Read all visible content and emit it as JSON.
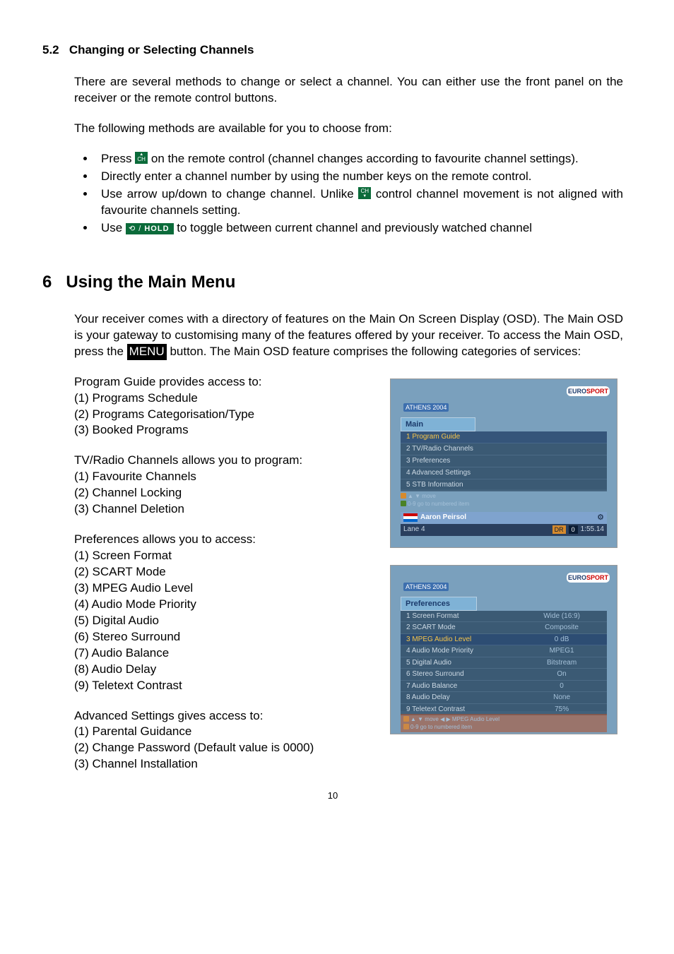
{
  "section52": {
    "number": "5.2",
    "title": "Changing or Selecting Channels",
    "intro": "There are several methods to change or select a channel. You can either use the front panel on the receiver or the remote control buttons.",
    "lead": "The following methods are available for you to choose from:",
    "b1a": "Press ",
    "b1b": " on the remote control (channel changes according to favourite channel settings).",
    "b2": "Directly enter a channel number by using the number keys on the remote control.",
    "b3a": "Use arrow up/down to change channel. Unlike ",
    "b3b": " control channel movement is not aligned with favourite channels setting.",
    "b4a": "Use ",
    "b4b": " to toggle between current channel and previously watched channel",
    "hold_label": "HOLD"
  },
  "section6": {
    "number": "6",
    "title": "Using the Main Menu",
    "intro_a": "Your receiver comes with a directory of features on the Main On Screen Display (OSD). The Main OSD is your gateway to customising many of the features offered by your receiver. To access the Main OSD, press the ",
    "menu_label": "MENU",
    "intro_b": " button. The Main OSD feature comprises the following categories of services:"
  },
  "blocks": {
    "pg_title": "Program Guide provides access to:",
    "pg_items": [
      "(1) Programs Schedule",
      "(2) Programs Categorisation/Type",
      "(3) Booked Programs"
    ],
    "tv_title": "TV/Radio Channels allows you to program:",
    "tv_items": [
      "(1) Favourite Channels",
      "(2) Channel Locking",
      "(3) Channel Deletion"
    ],
    "pref_title": "Preferences allows you to access:",
    "pref_items": [
      "(1) Screen Format",
      "(2) SCART Mode",
      "(3) MPEG Audio Level",
      "(4) Audio Mode Priority",
      "(5) Digital Audio",
      "(6) Stereo Surround",
      "(7) Audio Balance",
      "(8) Audio Delay",
      "(9) Teletext Contrast"
    ],
    "adv_title": "Advanced Settings gives access to:",
    "adv_items": [
      "(1) Parental Guidance",
      "(2) Change Password (Default value is 0000)",
      "(3) Channel Installation"
    ]
  },
  "fig1": {
    "chip": "ATHENS 2004",
    "panel_head": "Main",
    "rows": [
      "1 Program Guide",
      "2 TV/Radio Channels",
      "3 Preferences",
      "4 Advanced Settings",
      "5 STB Information"
    ],
    "selected_index": 0,
    "hint1": "▲ ▼ move",
    "hint2": "0-9 go to numbered item",
    "name": "Aaron Peirsol",
    "lane": "Lane 4",
    "dr": "DR",
    "boxnum": "0",
    "time": "1:55.14",
    "logo_a": "EURO",
    "logo_b": "SPORT"
  },
  "fig2": {
    "chip": "ATHENS 2004",
    "panel_head": "Preferences",
    "rows": [
      {
        "label": "1 Screen Format",
        "val": "Wide (16:9)"
      },
      {
        "label": "2 SCART Mode",
        "val": "Composite"
      },
      {
        "label": "3 MPEG Audio Level",
        "val": "0 dB"
      },
      {
        "label": "4 Audio Mode Priority",
        "val": "MPEG1"
      },
      {
        "label": "5 Digital Audio",
        "val": "Bitstream"
      },
      {
        "label": "6 Stereo Surround",
        "val": "On"
      },
      {
        "label": "7 Audio Balance",
        "val": "0"
      },
      {
        "label": "8 Audio Delay",
        "val": "None"
      },
      {
        "label": "9 Teletext Contrast",
        "val": "75%"
      }
    ],
    "selected_index": 2,
    "hint1": "▲ ▼ move  ◀ ▶  MPEG Audio Level",
    "hint2": "0-9 go to numbered item",
    "logo_a": "EURO",
    "logo_b": "SPORT"
  },
  "pagenum": "10"
}
